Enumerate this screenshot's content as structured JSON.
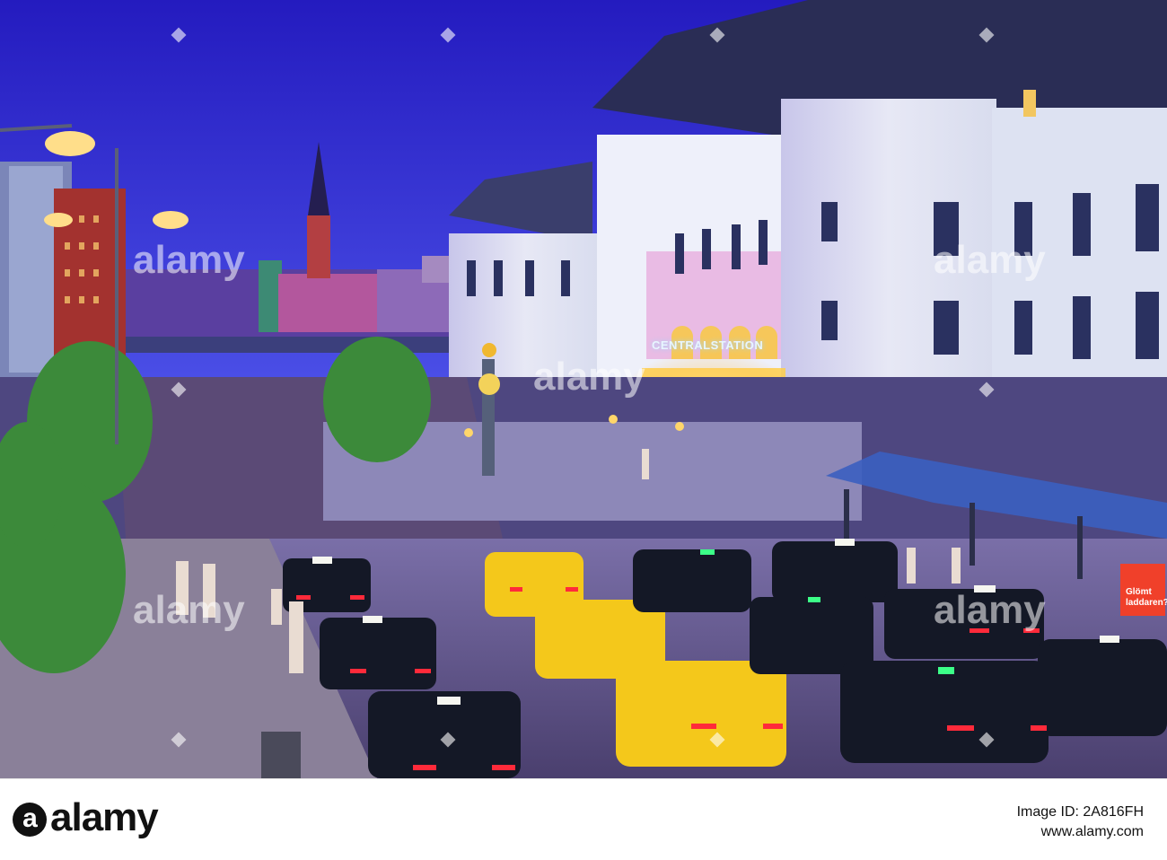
{
  "photo": {
    "station_sign": "CENTRALSTATION",
    "banner_text": "Glömt laddaren?",
    "watermark": "alamy",
    "colors": {
      "sky_top": "#2a23c9",
      "sky_bottom": "#3f44e0",
      "building": "#dfe4f0",
      "taxi_yellow": "#f4c81b",
      "taxi_black": "#161a26"
    }
  },
  "footer": {
    "logo": "alamy",
    "image_id_line": "Image ID: 2A816FH",
    "url": "www.alamy.com"
  }
}
